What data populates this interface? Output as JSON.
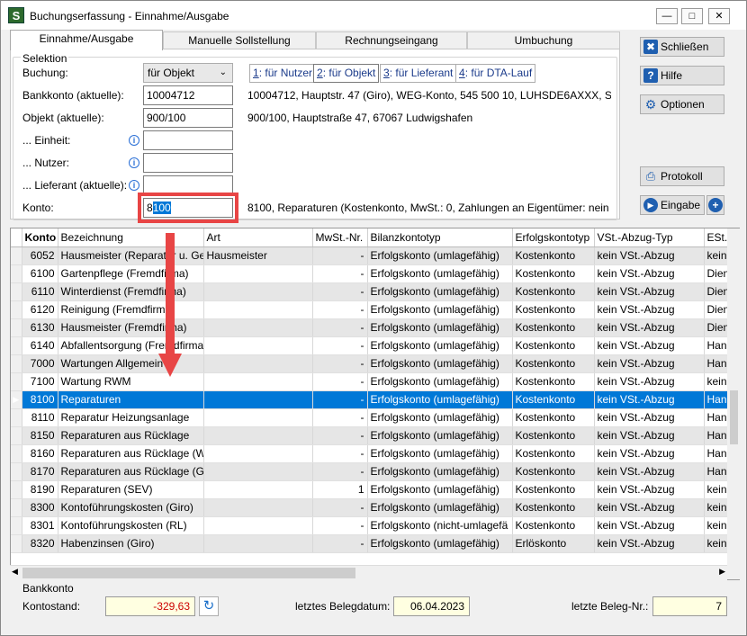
{
  "window": {
    "title": "Buchungserfassung - Einnahme/Ausgabe",
    "app_icon": "S"
  },
  "tabs": [
    {
      "label": "Einnahme/Ausgabe"
    },
    {
      "label": "Manuelle Sollstellung"
    },
    {
      "label": "Rechnungseingang"
    },
    {
      "label": "Umbuchung"
    }
  ],
  "selektion": {
    "group_label": "Selektion",
    "buchung_label": "Buchung:",
    "buchung_value": "für Objekt",
    "bankkonto_label": "Bankkonto (aktuelle):",
    "bankkonto_value": "10004712",
    "bankkonto_desc": "10004712,  Hauptstr. 47 (Giro),  WEG-Konto,  545 500 10,  LUHSDE6AXXX,  Spa",
    "objekt_label": "Objekt (aktuelle):",
    "objekt_value": "900/100",
    "objekt_desc": "900/100,  Hauptstraße 47, 67067 Ludwigshafen",
    "einheit_label": "... Einheit:",
    "nutzer_label": "... Nutzer:",
    "lieferant_label": "... Lieferant (aktuelle):",
    "konto_label": "Konto:",
    "konto_prefix": "8",
    "konto_selected": "100",
    "konto_desc": "8100,  Reparaturen  (Kostenkonto,  MwSt.: 0,  Zahlungen an Eigentümer: nein",
    "mode_buttons": [
      {
        "key": "1",
        "label": ": für Nutzer"
      },
      {
        "key": "2",
        "label": ": für Objekt"
      },
      {
        "key": "3",
        "label": ": für Lieferant"
      },
      {
        "key": "4",
        "label": ": für DTA-Lauf"
      }
    ]
  },
  "side_buttons": {
    "schliessen": "Schließen",
    "hilfe": "Hilfe",
    "optionen": "Optionen",
    "protokoll": "Protokoll",
    "eingabe": "Eingabe"
  },
  "grid": {
    "columns": [
      "Konto",
      "Bezeichnung",
      "Art",
      "MwSt.-Nr.",
      "Bilanzkontotyp",
      "Erfolgskontotyp",
      "VSt.-Abzug-Typ",
      "ESt."
    ],
    "rows": [
      [
        "6052",
        "Hausmeister (Reparatur u. Ge",
        "Hausmeister",
        "-",
        "Erfolgskonto (umlagefähig)",
        "Kostenkonto",
        "kein VSt.-Abzug",
        "kein"
      ],
      [
        "6100",
        "Gartenpflege (Fremdfirma)",
        "",
        "-",
        "Erfolgskonto (umlagefähig)",
        "Kostenkonto",
        "kein VSt.-Abzug",
        "Dien"
      ],
      [
        "6110",
        "Winterdienst (Fremdfirma)",
        "",
        "-",
        "Erfolgskonto (umlagefähig)",
        "Kostenkonto",
        "kein VSt.-Abzug",
        "Dien"
      ],
      [
        "6120",
        "Reinigung (Fremdfirma)",
        "",
        "-",
        "Erfolgskonto (umlagefähig)",
        "Kostenkonto",
        "kein VSt.-Abzug",
        "Dien"
      ],
      [
        "6130",
        "Hausmeister (Fremdfirma)",
        "",
        "-",
        "Erfolgskonto (umlagefähig)",
        "Kostenkonto",
        "kein VSt.-Abzug",
        "Dien"
      ],
      [
        "6140",
        "Abfallentsorgung (Fremdfirma",
        "",
        "-",
        "Erfolgskonto (umlagefähig)",
        "Kostenkonto",
        "kein VSt.-Abzug",
        "Han"
      ],
      [
        "7000",
        "Wartungen Allgemein",
        "",
        "-",
        "Erfolgskonto (umlagefähig)",
        "Kostenkonto",
        "kein VSt.-Abzug",
        "Han"
      ],
      [
        "7100",
        "Wartung RWM",
        "",
        "-",
        "Erfolgskonto (umlagefähig)",
        "Kostenkonto",
        "kein VSt.-Abzug",
        "kein"
      ],
      [
        "8100",
        "Reparaturen",
        "",
        "-",
        "Erfolgskonto (umlagefähig)",
        "Kostenkonto",
        "kein VSt.-Abzug",
        "Han"
      ],
      [
        "8110",
        "Reparatur Heizungsanlage",
        "",
        "-",
        "Erfolgskonto (umlagefähig)",
        "Kostenkonto",
        "kein VSt.-Abzug",
        "Han"
      ],
      [
        "8150",
        "Reparaturen aus Rücklage",
        "",
        "-",
        "Erfolgskonto (umlagefähig)",
        "Kostenkonto",
        "kein VSt.-Abzug",
        "Han"
      ],
      [
        "8160",
        "Reparaturen aus Rücklage (WI",
        "",
        "-",
        "Erfolgskonto (umlagefähig)",
        "Kostenkonto",
        "kein VSt.-Abzug",
        "Han"
      ],
      [
        "8170",
        "Reparaturen aus Rücklage (Ge",
        "",
        "-",
        "Erfolgskonto (umlagefähig)",
        "Kostenkonto",
        "kein VSt.-Abzug",
        "Han"
      ],
      [
        "8190",
        "Reparaturen (SEV)",
        "",
        "1",
        "Erfolgskonto (umlagefähig)",
        "Kostenkonto",
        "kein VSt.-Abzug",
        "kein"
      ],
      [
        "8300",
        "Kontoführungskosten (Giro)",
        "",
        "-",
        "Erfolgskonto (umlagefähig)",
        "Kostenkonto",
        "kein VSt.-Abzug",
        "kein"
      ],
      [
        "8301",
        "Kontoführungskosten (RL)",
        "",
        "-",
        "Erfolgskonto (nicht-umlagefä",
        "Kostenkonto",
        "kein VSt.-Abzug",
        "kein"
      ],
      [
        "8320",
        "Habenzinsen (Giro)",
        "",
        "-",
        "Erfolgskonto (umlagefähig)",
        "Erlöskonto",
        "kein VSt.-Abzug",
        "kein"
      ]
    ],
    "selected_index": 8
  },
  "bankkonto": {
    "section_label": "Bankkonto",
    "kontostand_label": "Kontostand:",
    "kontostand_value": "-329,63",
    "belegdatum_label": "letztes Belegdatum:",
    "belegdatum_value": "06.04.2023",
    "belegnr_label": "letzte Beleg-Nr.:",
    "belegnr_value": "7"
  },
  "colors": {
    "selection": "#0078d7",
    "highlight": "#e84545",
    "negative": "#cc0000",
    "field_yellow": "#ffffe1"
  }
}
